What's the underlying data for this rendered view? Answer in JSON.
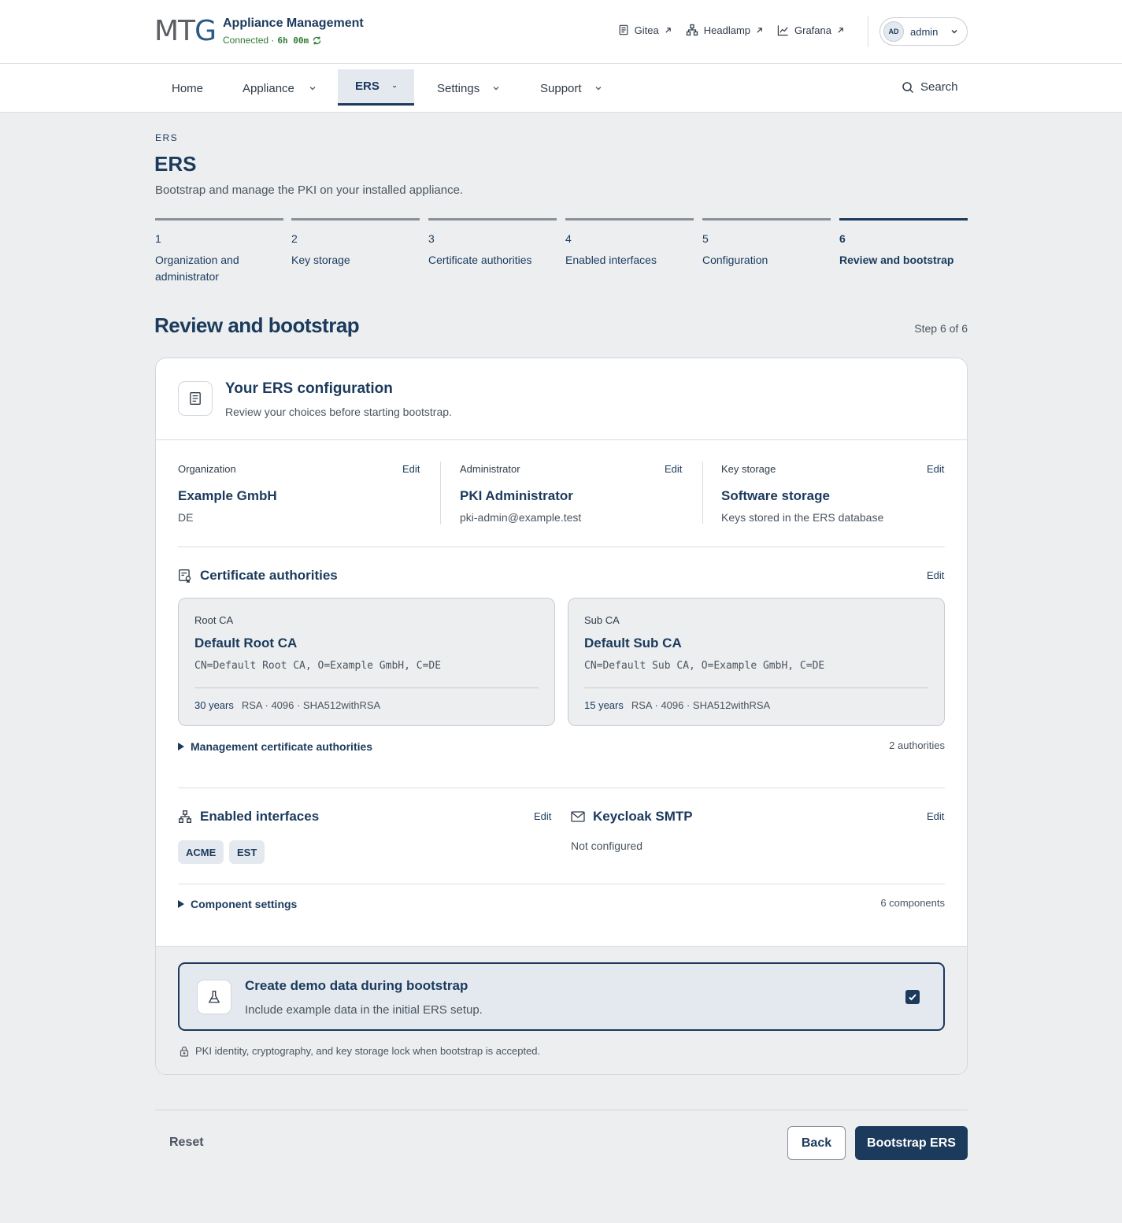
{
  "header": {
    "logo": "MTG",
    "app_title": "Appliance Management",
    "status": "Connected ·",
    "uptime": "6h 00m",
    "links": [
      {
        "label": "Gitea",
        "icon": "document-icon"
      },
      {
        "label": "Headlamp",
        "icon": "network-icon"
      },
      {
        "label": "Grafana",
        "icon": "chart-icon"
      }
    ],
    "user": {
      "initials": "AD",
      "name": "admin"
    }
  },
  "nav": {
    "items": [
      {
        "label": "Home"
      },
      {
        "label": "Appliance"
      },
      {
        "label": "ERS"
      },
      {
        "label": "Settings"
      },
      {
        "label": "Support"
      }
    ],
    "active": "ERS",
    "search": "Search"
  },
  "page": {
    "breadcrumb": "ERS",
    "title": "ERS",
    "description": "Bootstrap and manage the PKI on your installed appliance."
  },
  "stepper": [
    {
      "num": "1",
      "label": "Organization and administrator"
    },
    {
      "num": "2",
      "label": "Key storage"
    },
    {
      "num": "3",
      "label": "Certificate authorities"
    },
    {
      "num": "4",
      "label": "Enabled interfaces"
    },
    {
      "num": "5",
      "label": "Configuration"
    },
    {
      "num": "6",
      "label": "Review and bootstrap"
    }
  ],
  "section": {
    "title": "Review and bootstrap",
    "step_of": "Step 6 of 6"
  },
  "card": {
    "title": "Your ERS configuration",
    "subtitle": "Review your choices before starting bootstrap.",
    "edit_label": "Edit",
    "organization": {
      "label": "Organization",
      "value": "Example GmbH",
      "detail": "DE"
    },
    "administrator": {
      "label": "Administrator",
      "value": "PKI Administrator",
      "detail": "pki-admin@example.test"
    },
    "key_storage": {
      "label": "Key storage",
      "value": "Software storage",
      "detail": "Keys stored in the ERS database"
    },
    "cas": {
      "title": "Certificate authorities",
      "root": {
        "type": "Root CA",
        "name": "Default Root CA",
        "dn": "CN=Default Root CA, O=Example GmbH, C=DE",
        "validity": "30 years",
        "algo": "RSA · 4096 · SHA512withRSA"
      },
      "sub": {
        "type": "Sub CA",
        "name": "Default Sub CA",
        "dn": "CN=Default Sub CA, O=Example GmbH, C=DE",
        "validity": "15 years",
        "algo": "RSA · 4096 · SHA512withRSA"
      },
      "management_label": "Management certificate authorities",
      "management_count": "2 authorities"
    },
    "interfaces": {
      "title": "Enabled interfaces",
      "items": [
        "ACME",
        "EST"
      ]
    },
    "smtp": {
      "title": "Keycloak SMTP",
      "value": "Not configured"
    },
    "components": {
      "label": "Component settings",
      "count": "6 components"
    },
    "demo": {
      "title": "Create demo data during bootstrap",
      "description": "Include example data in the initial ERS setup.",
      "checked": true
    },
    "lock_note": "PKI identity, cryptography, and key storage lock when bootstrap is accepted."
  },
  "actions": {
    "reset": "Reset",
    "back": "Back",
    "primary": "Bootstrap ERS"
  },
  "colors": {
    "primary": "#1b3a5c",
    "background": "#eceef0",
    "success": "#2e7d32"
  }
}
